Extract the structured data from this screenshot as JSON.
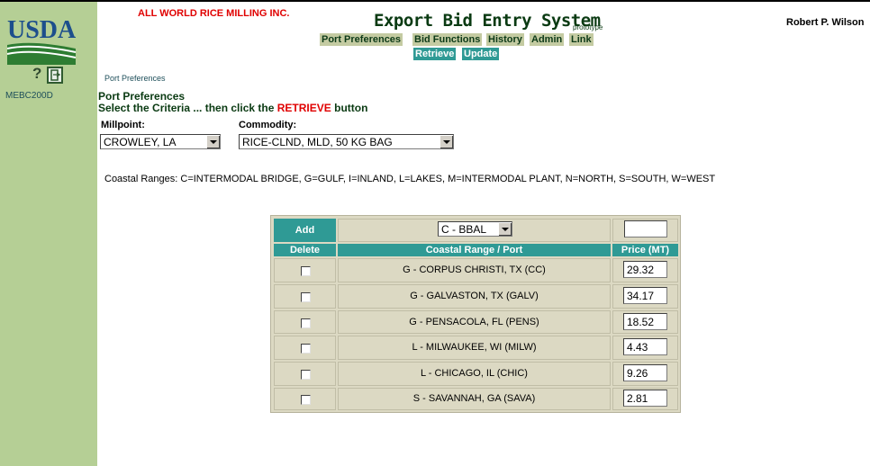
{
  "header": {
    "company": "ALL WORLD RICE MILLING INC.",
    "app_title": "Export Bid Entry System",
    "app_subtitle": "prototype",
    "user": "Robert P. Wilson",
    "logo_text": "USDA"
  },
  "sidebar": {
    "help_symbol": "?",
    "screen_id": "MEBC200D"
  },
  "menu": {
    "items": [
      "Port Preferences",
      "Bid Functions",
      "History",
      "Admin",
      "Link"
    ],
    "actions": [
      "Retrieve",
      "Update"
    ]
  },
  "breadcrumb": "Port Preferences",
  "page": {
    "section_title": "Port Preferences",
    "instruction_prefix": "Select the Criteria ... then click the",
    "instruction_keyword": "RETRIEVE",
    "instruction_suffix": "button",
    "millpoint_label": "Millpoint:",
    "millpoint_value": "CROWLEY, LA",
    "commodity_label": "Commodity:",
    "commodity_value": "RICE-CLND, MLD, 50 KG BAG",
    "coastal_legend": "Coastal Ranges: C=INTERMODAL BRIDGE, G=GULF, I=INLAND, L=LAKES, M=INTERMODAL PLANT, N=NORTH, S=SOUTH, W=WEST"
  },
  "grid": {
    "add_label": "Add",
    "add_port_value": "C - BBAL",
    "add_price_value": "",
    "headers": [
      "Delete",
      "Coastal Range / Port",
      "Price (MT)"
    ],
    "rows": [
      {
        "port": "G - CORPUS CHRISTI, TX (CC)",
        "price": "29.32"
      },
      {
        "port": "G - GALVASTON, TX (GALV)",
        "price": "34.17"
      },
      {
        "port": "G - PENSACOLA, FL (PENS)",
        "price": "18.52"
      },
      {
        "port": "L - MILWAUKEE, WI (MILW)",
        "price": "4.43"
      },
      {
        "port": "L - CHICAGO, IL (CHIC)",
        "price": "9.26"
      },
      {
        "port": "S - SAVANNAH, GA (SAVA)",
        "price": "2.81"
      }
    ]
  },
  "colors": {
    "sidebar": "#b5cf95",
    "menu_bg": "#c4cba2",
    "action_bg": "#2f9a95",
    "accent_red": "#e00000",
    "title_green": "#0a3a12"
  }
}
